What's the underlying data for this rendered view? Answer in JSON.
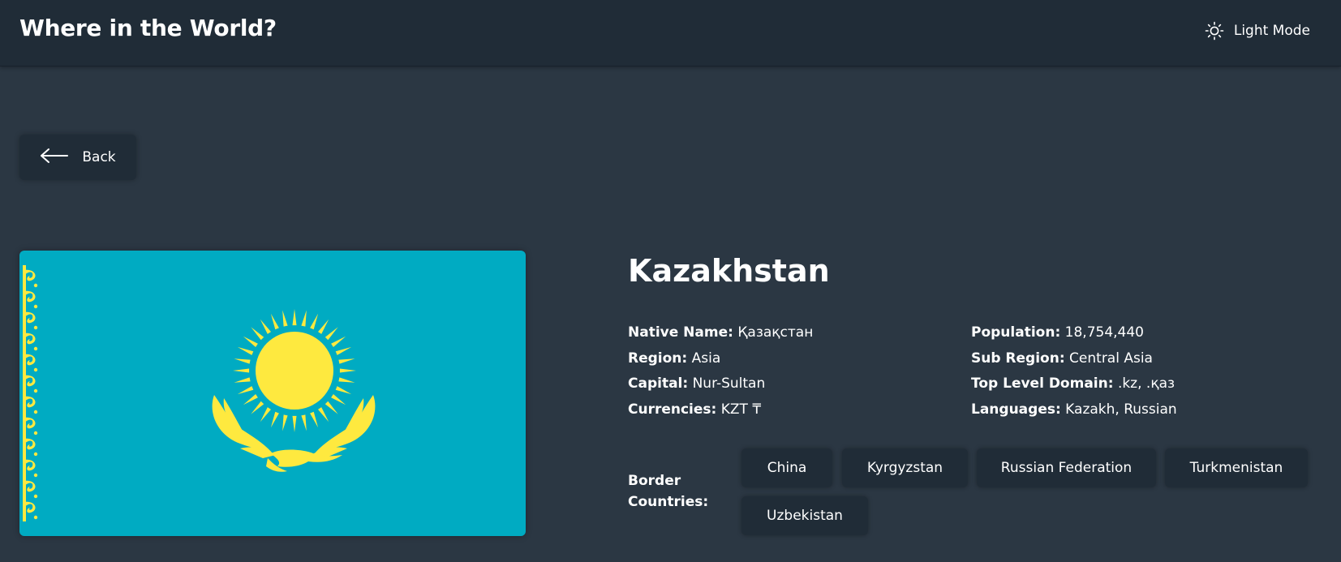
{
  "header": {
    "title": "Where in the World?",
    "mode_label": "Light Mode",
    "mode_icon": "sun-icon"
  },
  "back": {
    "label": "Back",
    "icon": "arrow-left-icon"
  },
  "country": {
    "name": "Kazakhstan",
    "flag_icon": "kazakhstan-flag",
    "flag_colors": {
      "field": "#00abc2",
      "emblem": "#fee93f"
    },
    "left": [
      {
        "label": "Native Name:",
        "value": "Қазақстан"
      },
      {
        "label": "Region:",
        "value": "Asia"
      },
      {
        "label": "Capital:",
        "value": "Nur-Sultan"
      },
      {
        "label": "Currencies:",
        "value": "KZT ₸"
      }
    ],
    "right": [
      {
        "label": "Population:",
        "value": "18,754,440"
      },
      {
        "label": "Sub Region:",
        "value": "Central Asia"
      },
      {
        "label": "Top Level Domain:",
        "value": ".kz, .қаз"
      },
      {
        "label": "Languages:",
        "value": "Kazakh, Russian"
      }
    ],
    "border_label": "Border Countries:",
    "borders": [
      "China",
      "Kyrgyzstan",
      "Russian Federation",
      "Turkmenistan",
      "Uzbekistan"
    ]
  },
  "theme": {
    "background": "#2b3743",
    "element": "#202c37",
    "text": "#ffffff"
  }
}
